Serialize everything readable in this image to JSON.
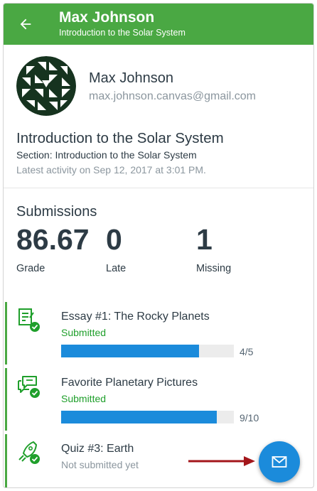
{
  "header": {
    "title": "Max Johnson",
    "subtitle": "Introduction to the Solar System",
    "back_icon": "arrow-left-icon",
    "color": "#4aa843"
  },
  "user": {
    "name": "Max Johnson",
    "email": "max.johnson.canvas@gmail.com",
    "avatar_icon": "geometric-avatar"
  },
  "course": {
    "title": "Introduction to the Solar System",
    "section": "Section: Introduction to the Solar System",
    "activity": "Latest activity on Sep 12, 2017 at 3:01 PM."
  },
  "submissions": {
    "heading": "Submissions",
    "stats": [
      {
        "value": "86.67",
        "label": "Grade"
      },
      {
        "value": "0",
        "label": "Late"
      },
      {
        "value": "1",
        "label": "Missing"
      }
    ],
    "items": [
      {
        "title": "Essay #1: The Rocky Planets",
        "status": "Submitted",
        "score": "4/5",
        "fraction": 0.8,
        "icon": "assignment-icon"
      },
      {
        "title": "Favorite Planetary Pictures",
        "status": "Submitted",
        "score": "9/10",
        "fraction": 0.9,
        "icon": "discussion-icon"
      },
      {
        "title": "Quiz #3: Earth",
        "status": "Not submitted yet",
        "icon": "quiz-rocket-icon"
      }
    ]
  },
  "fab": {
    "icon": "envelope-icon"
  },
  "colors": {
    "accent_blue": "#1b8bdb",
    "success_green": "#1f9f2b",
    "annotation_arrow": "#a3161b"
  }
}
